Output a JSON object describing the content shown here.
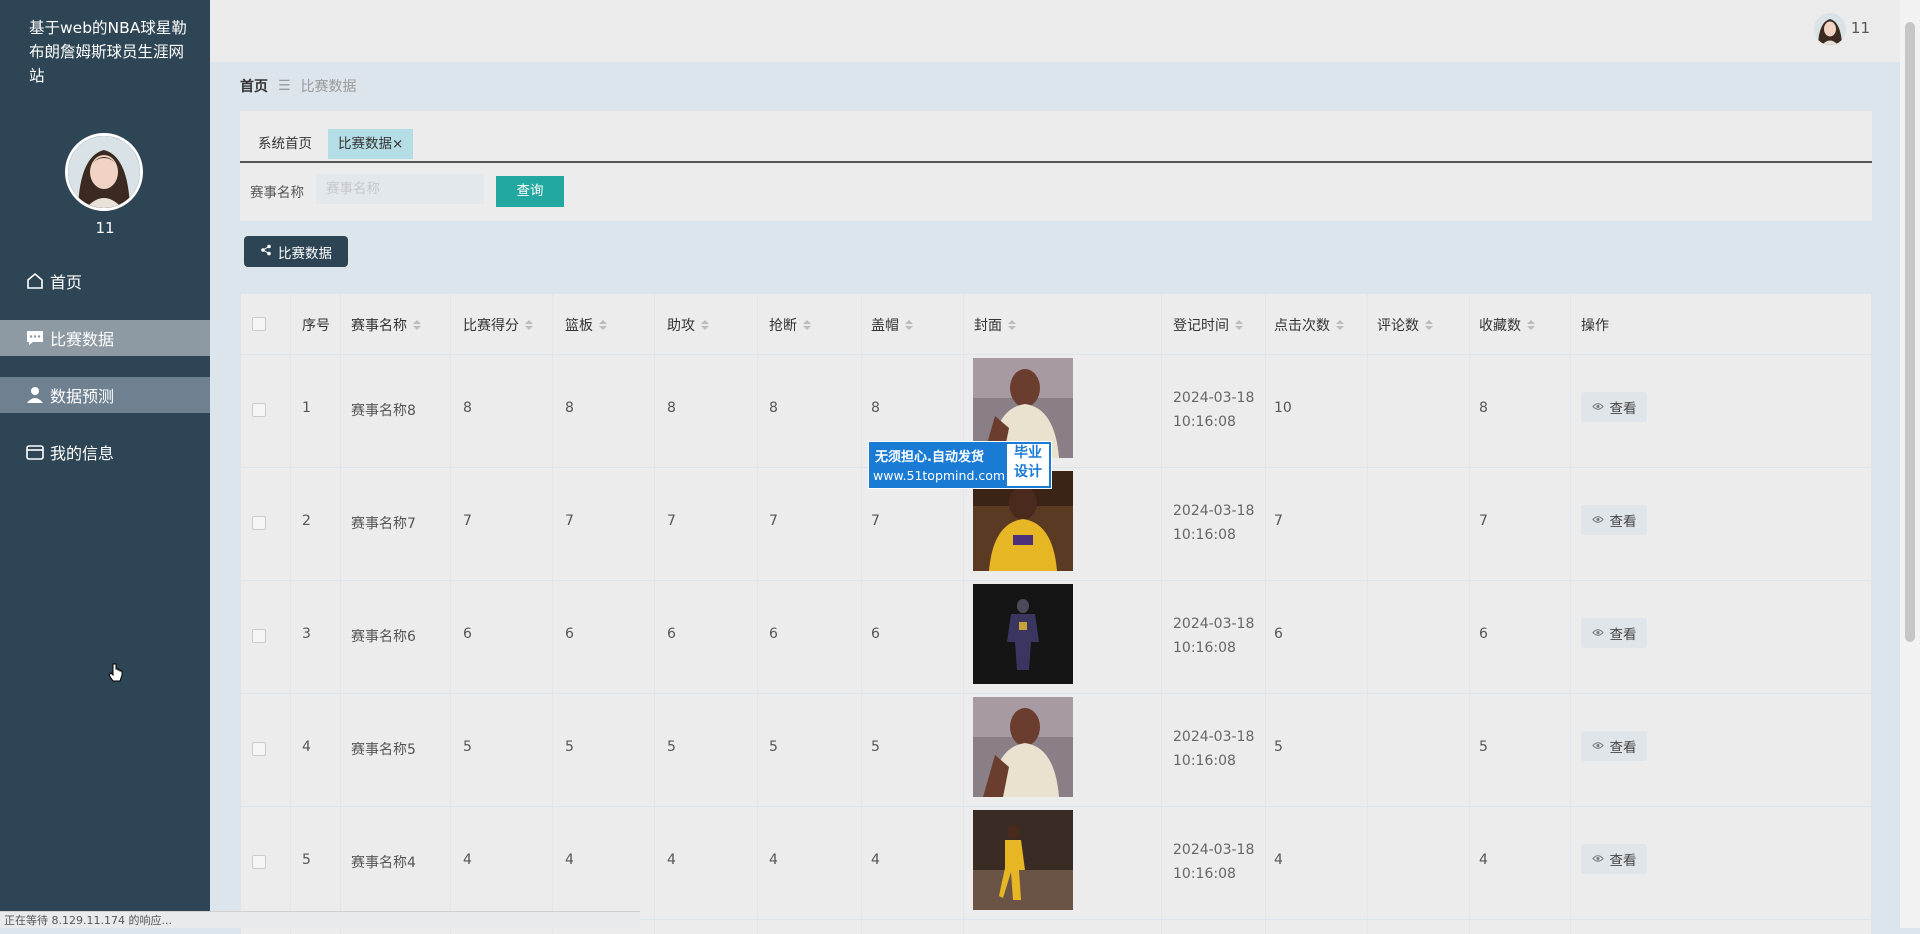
{
  "sidebar": {
    "site_title": "基于web的NBA球星勒布朗詹姆斯球员生涯网站",
    "username": "11",
    "items": [
      {
        "label": "首页",
        "icon": "home-icon"
      },
      {
        "label": "比赛数据",
        "icon": "message-icon"
      },
      {
        "label": "数据预测",
        "icon": "user-icon"
      },
      {
        "label": "我的信息",
        "icon": "card-icon"
      }
    ]
  },
  "topbar": {
    "username": "11"
  },
  "breadcrumb": {
    "home": "首页",
    "separator": "☰",
    "current": "比赛数据"
  },
  "tabs": [
    {
      "label": "系统首页"
    },
    {
      "label": "比赛数据",
      "close": "×"
    }
  ],
  "search": {
    "label": "赛事名称",
    "placeholder": "赛事名称",
    "value": "",
    "button": "查询"
  },
  "share_button": "比赛数据",
  "table": {
    "headers": [
      "序号",
      "赛事名称",
      "比赛得分",
      "篮板",
      "助攻",
      "抢断",
      "盖帽",
      "封面",
      "登记时间",
      "点击次数",
      "评论数",
      "收藏数",
      "操作"
    ],
    "rows": [
      {
        "no": "1",
        "name": "赛事名称8",
        "score": "8",
        "rebound": "8",
        "assist": "8",
        "steal": "8",
        "block": "8",
        "date": "2024-03-18",
        "time": "10:16:08",
        "clicks": "10",
        "comments": "",
        "favorites": "8",
        "action": "查看"
      },
      {
        "no": "2",
        "name": "赛事名称7",
        "score": "7",
        "rebound": "7",
        "assist": "7",
        "steal": "7",
        "block": "7",
        "date": "2024-03-18",
        "time": "10:16:08",
        "clicks": "7",
        "comments": "",
        "favorites": "7",
        "action": "查看"
      },
      {
        "no": "3",
        "name": "赛事名称6",
        "score": "6",
        "rebound": "6",
        "assist": "6",
        "steal": "6",
        "block": "6",
        "date": "2024-03-18",
        "time": "10:16:08",
        "clicks": "6",
        "comments": "",
        "favorites": "6",
        "action": "查看"
      },
      {
        "no": "4",
        "name": "赛事名称5",
        "score": "5",
        "rebound": "5",
        "assist": "5",
        "steal": "5",
        "block": "5",
        "date": "2024-03-18",
        "time": "10:16:08",
        "clicks": "5",
        "comments": "",
        "favorites": "5",
        "action": "查看"
      },
      {
        "no": "5",
        "name": "赛事名称4",
        "score": "4",
        "rebound": "4",
        "assist": "4",
        "steal": "4",
        "block": "4",
        "date": "2024-03-18",
        "time": "10:16:08",
        "clicks": "4",
        "comments": "",
        "favorites": "4",
        "action": "查看"
      }
    ]
  },
  "ad": {
    "line1": "无须担心.自动发货",
    "line2": "www.51topmind.com",
    "box1": "毕业",
    "box2": "设计"
  },
  "status_bar": "正在等待 8.129.11.174 的响应...",
  "colors": {
    "sidebar": "#2e4555",
    "accent": "#22a8a0",
    "active_tab": "#b5dde5"
  }
}
